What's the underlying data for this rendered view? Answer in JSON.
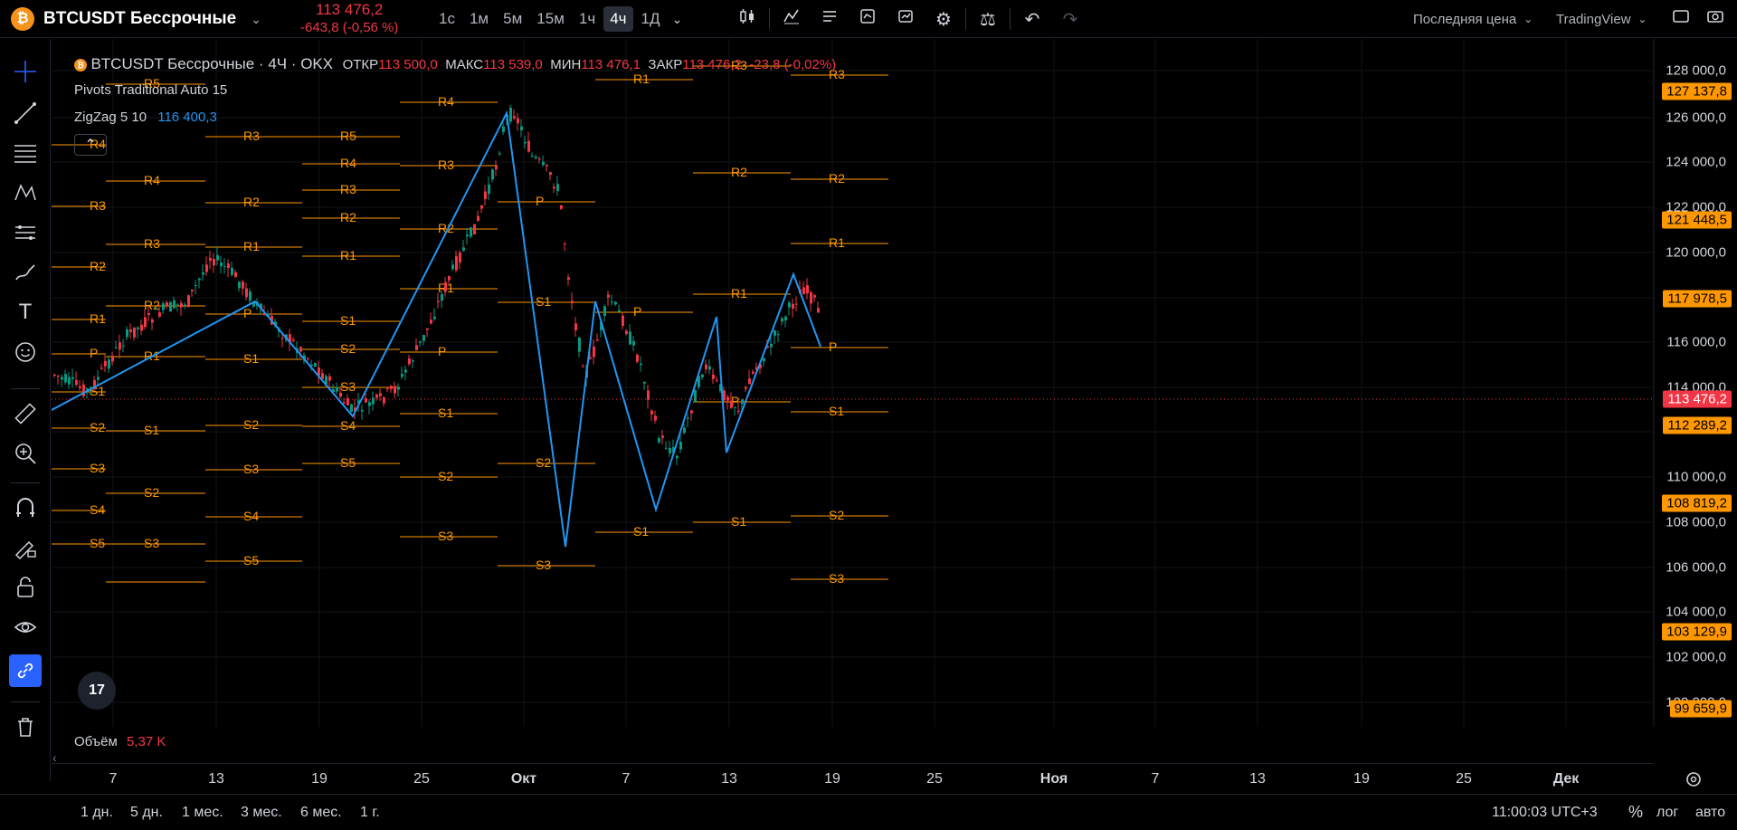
{
  "topbar": {
    "symbol": "BTCUSDT Бессрочные",
    "price": "113 476,2",
    "change": "-643,8 (-0,56 %)",
    "timeframes": [
      "1с",
      "1м",
      "5м",
      "15м",
      "1ч",
      "4ч",
      "1Д"
    ],
    "active_timeframe": "4ч",
    "price_type": "Последняя цена",
    "source": "TradingView"
  },
  "legend": {
    "title": "BTCUSDT Бессрочные · 4Ч · OKX",
    "open_label": "ОТКР",
    "open": "113 500,0",
    "high_label": "МАКС",
    "high": "113 539,0",
    "low_label": "МИН",
    "low": "113 476,1",
    "close_label": "ЗАКР",
    "close": "113 476,2",
    "close_change": "-23,8 (-0,02%)",
    "pivots": "Pivots Traditional Auto 15",
    "zigzag": "ZigZag 5 10",
    "zigzag_value": "116 400,3"
  },
  "volume": {
    "label": "Объём",
    "value": "5,37 K"
  },
  "price_axis": {
    "labels": [
      "128 000,0",
      "126 000,0",
      "124 000,0",
      "122 000,0",
      "120 000,0",
      "116 000,0",
      "114 000,0",
      "110 000,0",
      "108 000,0",
      "106 000,0",
      "104 000,0",
      "102 000,0",
      "100 000,0"
    ],
    "tags": [
      {
        "text": "127 137,8",
        "style": "orange"
      },
      {
        "text": "121 448,5",
        "style": "orange"
      },
      {
        "text": "117 978,5",
        "style": "orange"
      },
      {
        "text": "113 476,2",
        "style": "red"
      },
      {
        "text": "112 289,2",
        "style": "orange"
      },
      {
        "text": "108 819,2",
        "style": "orange"
      },
      {
        "text": "103 129,9",
        "style": "orange"
      },
      {
        "text": "99 659,9",
        "style": "orange"
      }
    ]
  },
  "time_axis": [
    "7",
    "13",
    "19",
    "25",
    "Окт",
    "7",
    "13",
    "19",
    "25",
    "Ноя",
    "7",
    "13",
    "19",
    "25",
    "Дек"
  ],
  "bottom": {
    "ranges": [
      "1 дн.",
      "5 дн.",
      "1 мес.",
      "3 мес.",
      "6 мес.",
      "1 г."
    ],
    "clock": "11:00:03 UTC+3",
    "percent": "%",
    "log": "лог",
    "auto": "авто"
  },
  "colors": {
    "up": "#089981",
    "down": "#f23645",
    "pivot": "#ff9800",
    "zigzag": "#2196f3"
  }
}
